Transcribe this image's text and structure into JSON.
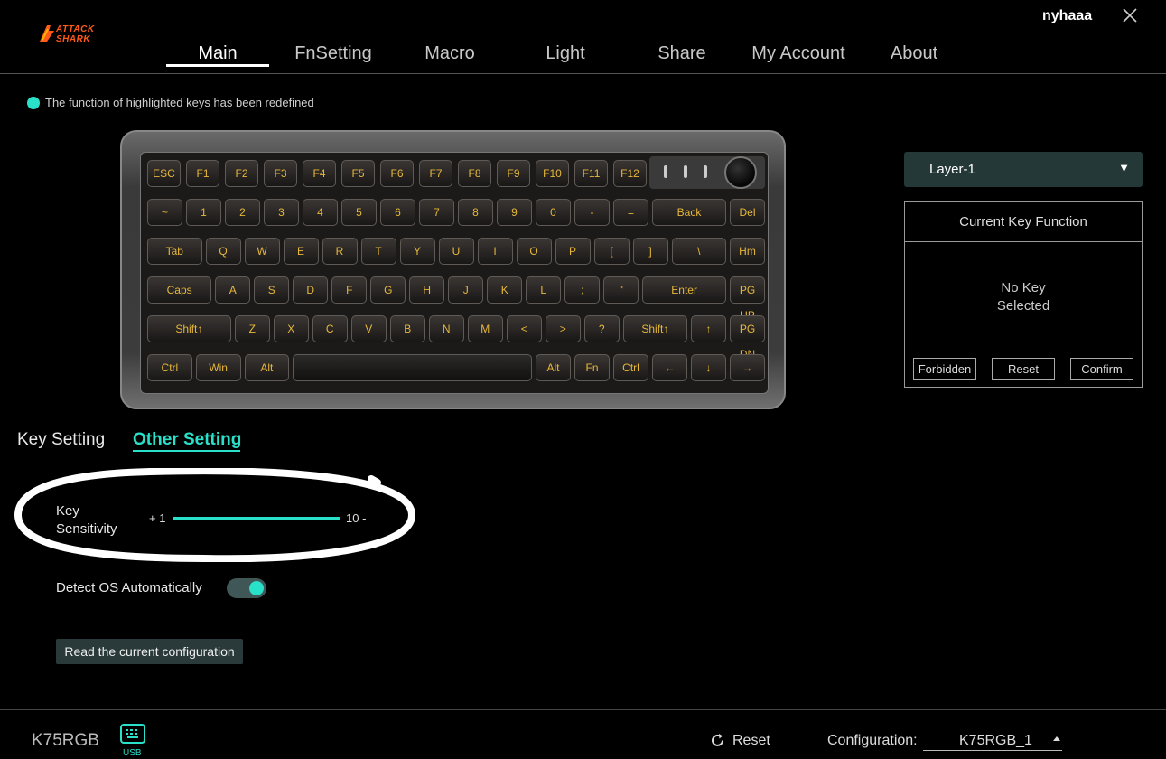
{
  "header": {
    "brand": "ATTACK SHARK",
    "user": "nyhaaa",
    "nav": [
      "Main",
      "FnSetting",
      "Macro",
      "Light",
      "Share",
      "My Account",
      "About"
    ],
    "active_nav": "Main"
  },
  "legend": {
    "text": "The function of highlighted keys has been redefined",
    "color": "#29e0c9"
  },
  "keyboard": {
    "rows": [
      [
        "ESC",
        "F1",
        "F2",
        "F3",
        "F4",
        "F5",
        "F6",
        "F7",
        "F8",
        "F9",
        "F10",
        "F11",
        "F12"
      ],
      [
        "~",
        "1",
        "2",
        "3",
        "4",
        "5",
        "6",
        "7",
        "8",
        "9",
        "0",
        "-",
        "=",
        "Back",
        "Del"
      ],
      [
        "Tab",
        "Q",
        "W",
        "E",
        "R",
        "T",
        "Y",
        "U",
        "I",
        "O",
        "P",
        "[",
        "]",
        "\\",
        "Hm"
      ],
      [
        "Caps",
        "A",
        "S",
        "D",
        "F",
        "G",
        "H",
        "J",
        "K",
        "L",
        ";",
        "\"",
        "Enter",
        "PG UP"
      ],
      [
        "Shift↑",
        "Z",
        "X",
        "C",
        "V",
        "B",
        "N",
        "M",
        "<",
        ">",
        "?",
        "Shift↑",
        "↑",
        "PG DN"
      ],
      [
        "Ctrl",
        "Win",
        "Alt",
        "",
        "Alt",
        "Fn",
        "Ctrl",
        "←",
        "↓",
        "→"
      ]
    ]
  },
  "right_panel": {
    "layer": "Layer-1",
    "title": "Current Key Function",
    "none_line1": "No Key",
    "none_line2": "Selected",
    "buttons": [
      "Forbidden",
      "Reset",
      "Confirm"
    ]
  },
  "settings": {
    "tabs": [
      "Key Setting",
      "Other Setting"
    ],
    "active_tab": "Other Setting",
    "sensitivity_line1": "Key",
    "sensitivity_line2": "Sensitivity",
    "sensitivity_min": "+ 1",
    "sensitivity_max": "10 -",
    "sensitivity_value_fraction": 1.0,
    "detect_os_label": "Detect OS Automatically",
    "detect_os_on": true,
    "read_button": "Read the current configuration"
  },
  "footer": {
    "device": "K75RGB",
    "usb_label": "USB",
    "reset": "Reset",
    "config_label": "Configuration:",
    "config_value": "K75RGB_1"
  },
  "colors": {
    "accent": "#29e0c9",
    "keycap_text": "#e6b73a",
    "panel_bg": "#253838"
  }
}
